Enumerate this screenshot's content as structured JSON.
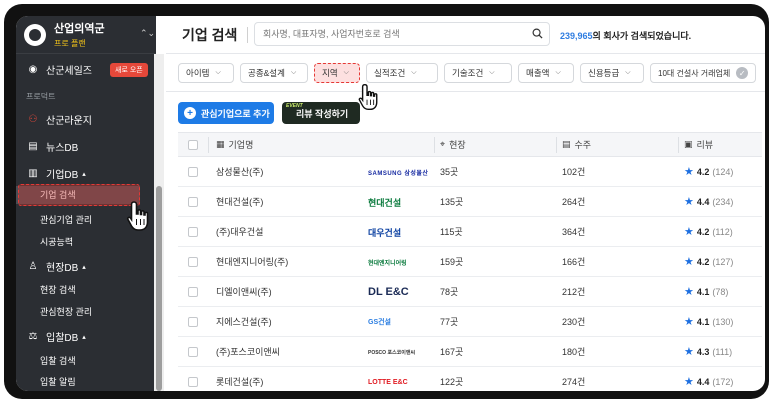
{
  "app": {
    "brand_name": "산업의역군",
    "brand_plan": "프로 플랜",
    "page_title": "기업 검색"
  },
  "sidebar": {
    "top_item": {
      "label": "산군세일즈",
      "badge": "새로 오픈"
    },
    "section_label": "프로덕트",
    "items": [
      {
        "label": "산군라운지",
        "icon": "lounge-icon"
      },
      {
        "label": "뉴스DB",
        "icon": "news-icon"
      },
      {
        "label": "기업DB",
        "icon": "chart-icon",
        "expanded": true,
        "arrow": "▴",
        "children": [
          "기업 검색",
          "관심기업 관리",
          "시공능력"
        ]
      },
      {
        "label": "현장DB",
        "icon": "site-icon",
        "expanded": true,
        "arrow": "▴",
        "children": [
          "현장 검색",
          "관심현장 관리"
        ]
      },
      {
        "label": "입찰DB",
        "icon": "bid-icon",
        "expanded": true,
        "arrow": "▴",
        "children": [
          "입찰 검색",
          "입찰 알림"
        ]
      }
    ]
  },
  "search": {
    "placeholder": "회사명, 대표자명, 사업자번호로 검색"
  },
  "result": {
    "count": "239,965",
    "suffix": "의 회사가 검색되었습니다."
  },
  "filters": [
    "아이템",
    "공종&설계",
    "지역",
    "실적조건",
    "기술조건",
    "매출액",
    "신용등급",
    "10대 건설사 거래업체"
  ],
  "actions": {
    "add_label": "관심기업으로 추가",
    "review_label": "리뷰 작성하기",
    "review_tag": "EVENT"
  },
  "table": {
    "headers": [
      "기업명",
      "현장",
      "수주",
      "리뷰"
    ],
    "rows": [
      {
        "name": "삼성물산(주)",
        "logo": "SAMSUNG 삼성물산",
        "sites": "35곳",
        "orders": "102건",
        "score": "4.2",
        "reviews": "(124)"
      },
      {
        "name": "현대건설(주)",
        "logo": "현대건설",
        "sites": "135곳",
        "orders": "264건",
        "score": "4.4",
        "reviews": "(234)"
      },
      {
        "name": "(주)대우건설",
        "logo": "대우건설",
        "sites": "115곳",
        "orders": "364건",
        "score": "4.2",
        "reviews": "(112)"
      },
      {
        "name": "현대엔지니어링(주)",
        "logo": "현대엔지니어링",
        "sites": "159곳",
        "orders": "166건",
        "score": "4.2",
        "reviews": "(127)"
      },
      {
        "name": "디엘이앤씨(주)",
        "logo": "DL E&C",
        "sites": "78곳",
        "orders": "212건",
        "score": "4.1",
        "reviews": "(78)"
      },
      {
        "name": "지에스건설(주)",
        "logo": "GS건설",
        "sites": "77곳",
        "orders": "230건",
        "score": "4.1",
        "reviews": "(130)"
      },
      {
        "name": "(주)포스코이앤씨",
        "logo": "POSCO 포스코이앤씨",
        "sites": "167곳",
        "orders": "180건",
        "score": "4.3",
        "reviews": "(111)"
      },
      {
        "name": "롯데건설(주)",
        "logo": "LOTTE E&C",
        "sites": "122곳",
        "orders": "274건",
        "score": "4.4",
        "reviews": "(172)"
      }
    ]
  },
  "colors": {
    "accent": "#1e7be6",
    "sidebar": "#2b2e33",
    "highlight": "#e53935"
  }
}
